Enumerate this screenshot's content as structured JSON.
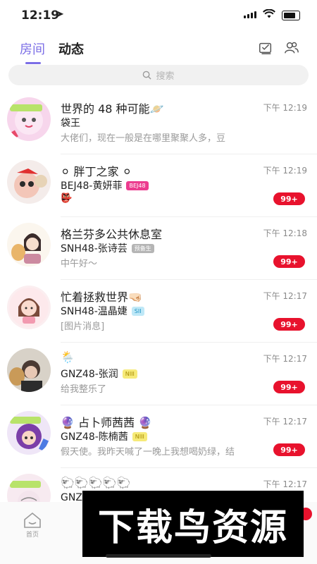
{
  "status_bar": {
    "time": "12:19",
    "location_arrow": "➤"
  },
  "header": {
    "tabs": [
      "房间",
      "动态"
    ],
    "right_icons": [
      "checklist-icon",
      "contacts-icon"
    ]
  },
  "search": {
    "placeholder": "搜索"
  },
  "rooms": [
    {
      "title": "世界的 48 种可能🪐",
      "time": "下午 12:19",
      "sender": "袋王",
      "tag": "",
      "preview": "大佬们，现在一般是在哪里聚聚人多，豆",
      "badge": ""
    },
    {
      "title": "⚪ 胖丁之家 ⚪",
      "time": "下午 12:19",
      "sender": "BEJ48-黄妍菲",
      "tag": "BEJ48",
      "preview": "👺",
      "badge": "99+"
    },
    {
      "title": "格兰芬多公共休息室",
      "time": "下午 12:18",
      "sender": "SNH48-张诗芸",
      "tag": "预备生",
      "preview": "中午好～",
      "badge": "99+"
    },
    {
      "title": "忙着拯救世界🤜🏻",
      "time": "下午 12:17",
      "sender": "SNH48-温晶婕",
      "tag": "SII",
      "preview": "[图片消息]",
      "badge": "99+"
    },
    {
      "title": "🌦️",
      "time": "下午 12:17",
      "sender": "GNZ48-张润",
      "tag": "NIII",
      "preview": "给我整乐了",
      "badge": "99+"
    },
    {
      "title": "🔮 占卜师茜茜 🔮",
      "time": "下午 12:17",
      "sender": "GNZ48-陈楠茜",
      "tag": "NIII",
      "preview": "假天使。我昨天喊了一晚上我想喝奶绿，结",
      "badge": "99+"
    },
    {
      "title": "🐑🐑🐑🐑🐑",
      "time": "下午 12:17",
      "sender": "GNZ",
      "tag": "",
      "preview": "",
      "badge": ""
    }
  ],
  "tabbar": {
    "home_label": "首页"
  },
  "watermark": "下载鸟资源",
  "colors": {
    "accent": "#7b6ee6",
    "badge": "#e8122d"
  }
}
